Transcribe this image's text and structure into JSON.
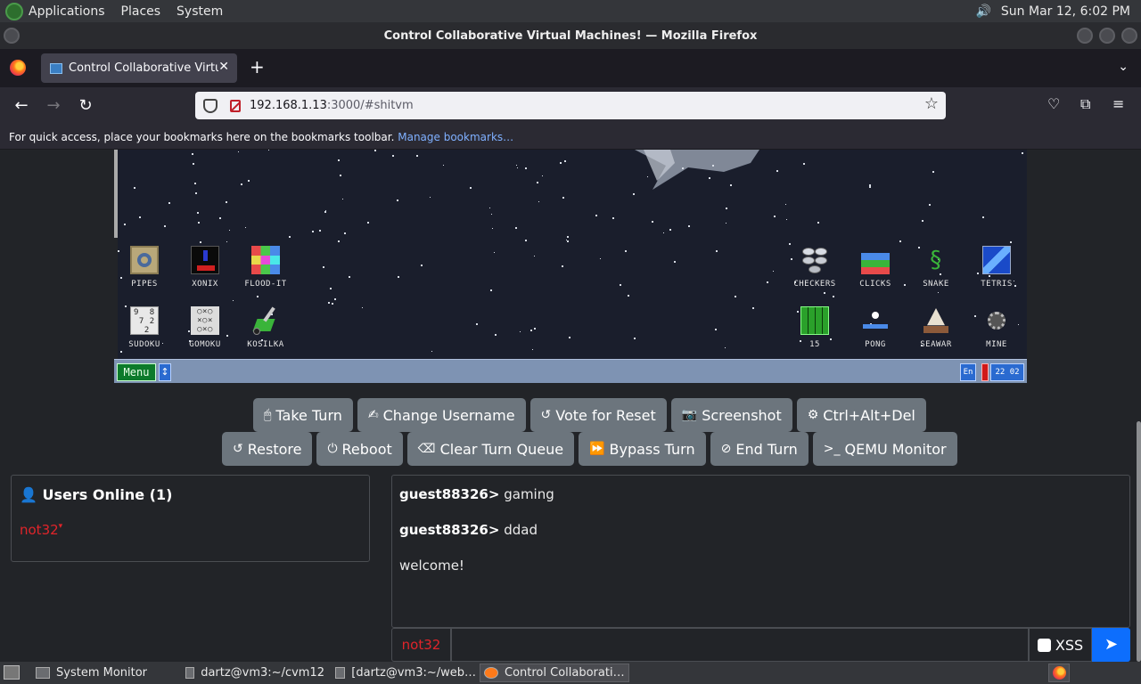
{
  "os_panel": {
    "menus": [
      "Applications",
      "Places",
      "System"
    ],
    "clock": "Sun Mar 12,  6:02 PM"
  },
  "window": {
    "title": "Control Collaborative Virtual Machines! — Mozilla Firefox"
  },
  "browser": {
    "tab_title": "Control Collaborative Virtual Machines!",
    "url_host": "192.168.1.13",
    "url_rest": ":3000/#shitvm",
    "bookmarks_hint": "For quick access, place your bookmarks here on the bookmarks toolbar.",
    "manage_bookmarks": "Manage bookmarks…"
  },
  "vm_desktop": {
    "icons_left": [
      "PIPES",
      "XONIX",
      "FLOOD-IT",
      "SUDOKU",
      "GOMOKU",
      "KOSILKA"
    ],
    "icons_right": [
      "CHECKERS",
      "CLICKS",
      "SNAKE",
      "TETRIS",
      "15",
      "PONG",
      "SEAWAR",
      "MINE"
    ],
    "taskbar": {
      "menu": "Menu",
      "switch": "↕",
      "lang": "En",
      "clock": "22 02"
    }
  },
  "controls": {
    "row1": [
      {
        "icon": "🖱",
        "label": "Take Turn"
      },
      {
        "icon": "✍",
        "label": "Change Username"
      },
      {
        "icon": "↺",
        "label": "Vote for Reset"
      },
      {
        "icon": "📷",
        "label": "Screenshot"
      },
      {
        "icon": "⚙",
        "label": "Ctrl+Alt+Del"
      }
    ],
    "row2": [
      {
        "icon": "↺",
        "label": "Restore"
      },
      {
        "icon": "⏻",
        "label": "Reboot"
      },
      {
        "icon": "⌫",
        "label": "Clear Turn Queue"
      },
      {
        "icon": "⏩",
        "label": "Bypass Turn"
      },
      {
        "icon": "⊘",
        "label": "End Turn"
      },
      {
        "icon": ">_",
        "label": "QEMU Monitor"
      }
    ]
  },
  "users_panel": {
    "header": "Users Online (1)",
    "users": [
      "not32"
    ]
  },
  "chat": {
    "messages": [
      {
        "user": "guest88326>",
        "text": "gaming"
      },
      {
        "user": "guest88326>",
        "text": "ddad"
      },
      {
        "user": "",
        "text": "welcome!"
      }
    ],
    "username": "not32",
    "input_value": "",
    "xss_label": "XSS"
  },
  "os_taskbar": {
    "items": [
      "System Monitor",
      "dartz@vm3:~/cvm12",
      "[dartz@vm3:~/web…",
      "Control Collaborati…"
    ]
  },
  "colors": {
    "accent": "#0d6efd",
    "user_red": "#e0242a",
    "button_gray": "#6c757d",
    "vm_menu_green": "#0c7a2b"
  }
}
